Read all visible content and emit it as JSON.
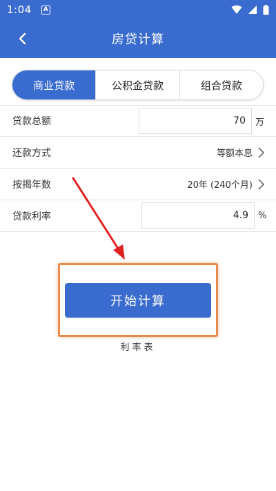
{
  "status_bar": {
    "time": "1:04",
    "notification_icon": "A"
  },
  "header": {
    "title": "房贷计算"
  },
  "tabs": [
    {
      "label": "商业贷款",
      "active": true
    },
    {
      "label": "公积金贷款",
      "active": false
    },
    {
      "label": "组合贷款",
      "active": false
    }
  ],
  "form": {
    "loan_total": {
      "label": "贷款总额",
      "value": "70",
      "unit": "万"
    },
    "repayment_method": {
      "label": "还款方式",
      "value": "等额本息"
    },
    "mortgage_years": {
      "label": "按揭年数",
      "value": "20年 (240个月)"
    },
    "loan_rate": {
      "label": "贷款利率",
      "value": "4.9",
      "unit": "%"
    }
  },
  "actions": {
    "start_label": "开始计算",
    "rate_table_label": "利率表"
  },
  "colors": {
    "primary": "#3a6ccf",
    "highlight": "#e8894f",
    "arrow": "#e02020"
  }
}
